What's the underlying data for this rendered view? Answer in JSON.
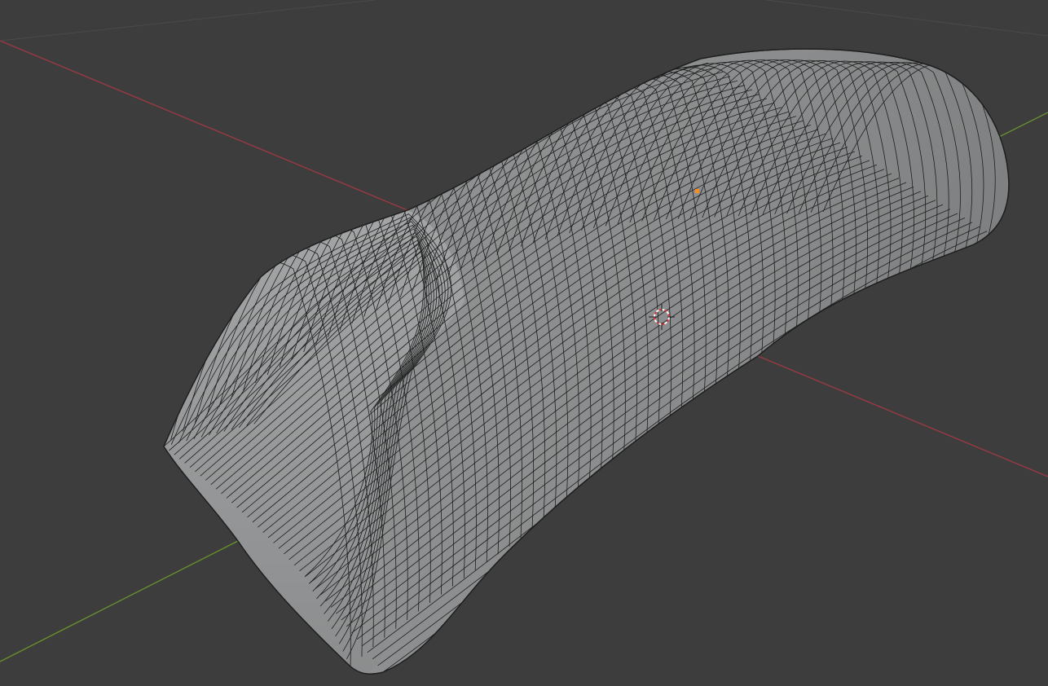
{
  "viewport": {
    "name": "3D Viewport",
    "background_color": "#3d3d3d",
    "grid_line_color": "#4a4a4a",
    "x_axis_color": "#9a3a45",
    "y_axis_color": "#6a8f2e",
    "mesh_fill_color": "#9a9c9d",
    "mesh_wire_color": "#1e1e1e",
    "origin_color": "#ff8c1a",
    "cursor_colors": [
      "#d83a3a",
      "#ffffff"
    ]
  },
  "scene": {
    "object": "mesh-object",
    "wireframe_visible": true,
    "origin_point_visible": true,
    "cursor_visible": true
  }
}
